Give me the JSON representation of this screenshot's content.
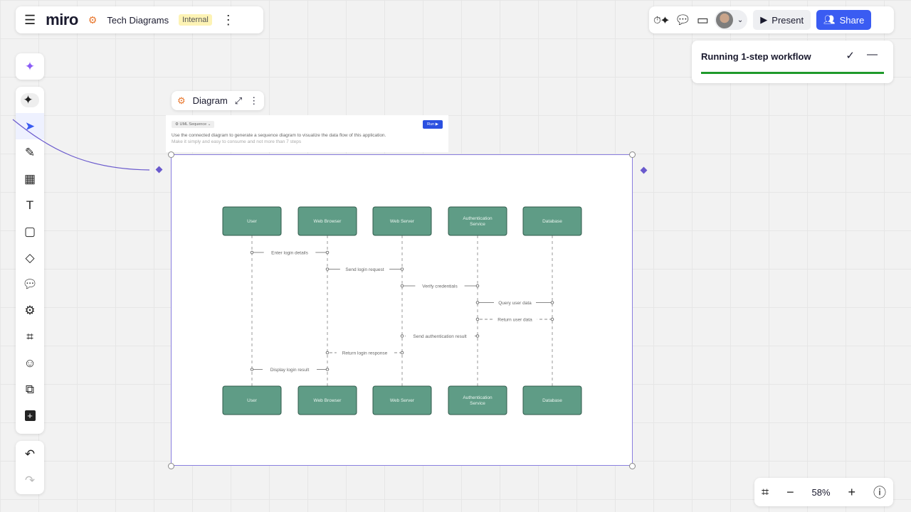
{
  "header": {
    "menu_icon": "hamburger-icon",
    "logo": "miro",
    "board_title": "Tech Diagrams",
    "board_badge": "Internal"
  },
  "topright": {
    "present_label": "Present",
    "share_label": "Share",
    "accent": "#3a5cf2"
  },
  "workflow": {
    "title": "Running 1-step workflow",
    "progress": 1.0,
    "color": "#1f9a2b"
  },
  "diagram_toolbar": {
    "label": "Diagram"
  },
  "prompt": {
    "type": "UML Sequence",
    "run_label": "Run",
    "text_line1": "Use the connected diagram to generate a sequence diagram to visualize the data flow of this application.",
    "text_line2": "Make it simply and easy to consume and not more than 7 steps"
  },
  "sequence": {
    "participants": [
      "User",
      "Web Browser",
      "Web Server",
      "Authentication Service",
      "Database"
    ],
    "messages": [
      {
        "from": 0,
        "to": 1,
        "label": "Enter login details",
        "dashed": false
      },
      {
        "from": 1,
        "to": 2,
        "label": "Send login request",
        "dashed": false
      },
      {
        "from": 2,
        "to": 3,
        "label": "Verify credentials",
        "dashed": false
      },
      {
        "from": 3,
        "to": 4,
        "label": "Query user data",
        "dashed": false
      },
      {
        "from": 4,
        "to": 3,
        "label": "Return user data",
        "dashed": true
      },
      {
        "from": 3,
        "to": 2,
        "label": "Send authentication result",
        "dashed": true
      },
      {
        "from": 2,
        "to": 1,
        "label": "Return login response",
        "dashed": true
      },
      {
        "from": 1,
        "to": 0,
        "label": "Display login result",
        "dashed": false
      }
    ],
    "box_color": "#5f9c86"
  },
  "zoom": {
    "level": "58%"
  }
}
